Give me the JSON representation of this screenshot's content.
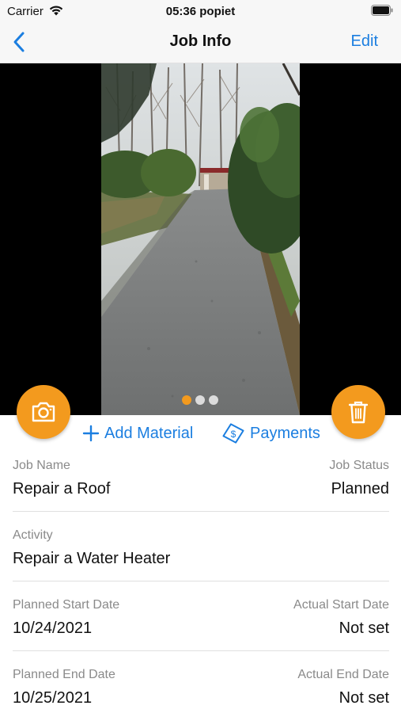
{
  "status_bar": {
    "carrier": "Carrier",
    "time": "05:36 popiet"
  },
  "nav": {
    "title": "Job Info",
    "edit_label": "Edit"
  },
  "gallery": {
    "page_count": 3,
    "current_page": 1
  },
  "actions": {
    "add_material_label": "Add Material",
    "payments_label": "Payments"
  },
  "details": {
    "job_name_label": "Job Name",
    "job_name": "Repair a Roof",
    "job_status_label": "Job Status",
    "job_status": "Planned",
    "activity_label": "Activity",
    "activity": "Repair a Water Heater",
    "planned_start_label": "Planned Start Date",
    "planned_start": "10/24/2021",
    "actual_start_label": "Actual Start Date",
    "actual_start": "Not set",
    "planned_end_label": "Planned End Date",
    "planned_end": "10/25/2021",
    "actual_end_label": "Actual End Date",
    "actual_end": "Not set"
  },
  "colors": {
    "accent_orange": "#f39a1e",
    "link_blue": "#1b7ee0"
  },
  "icons": {
    "back": "chevron-left-icon",
    "wifi": "wifi-icon",
    "battery": "battery-icon",
    "camera": "camera-icon",
    "trash": "trash-icon",
    "add": "plus-icon",
    "payments": "payment-tag-icon"
  }
}
